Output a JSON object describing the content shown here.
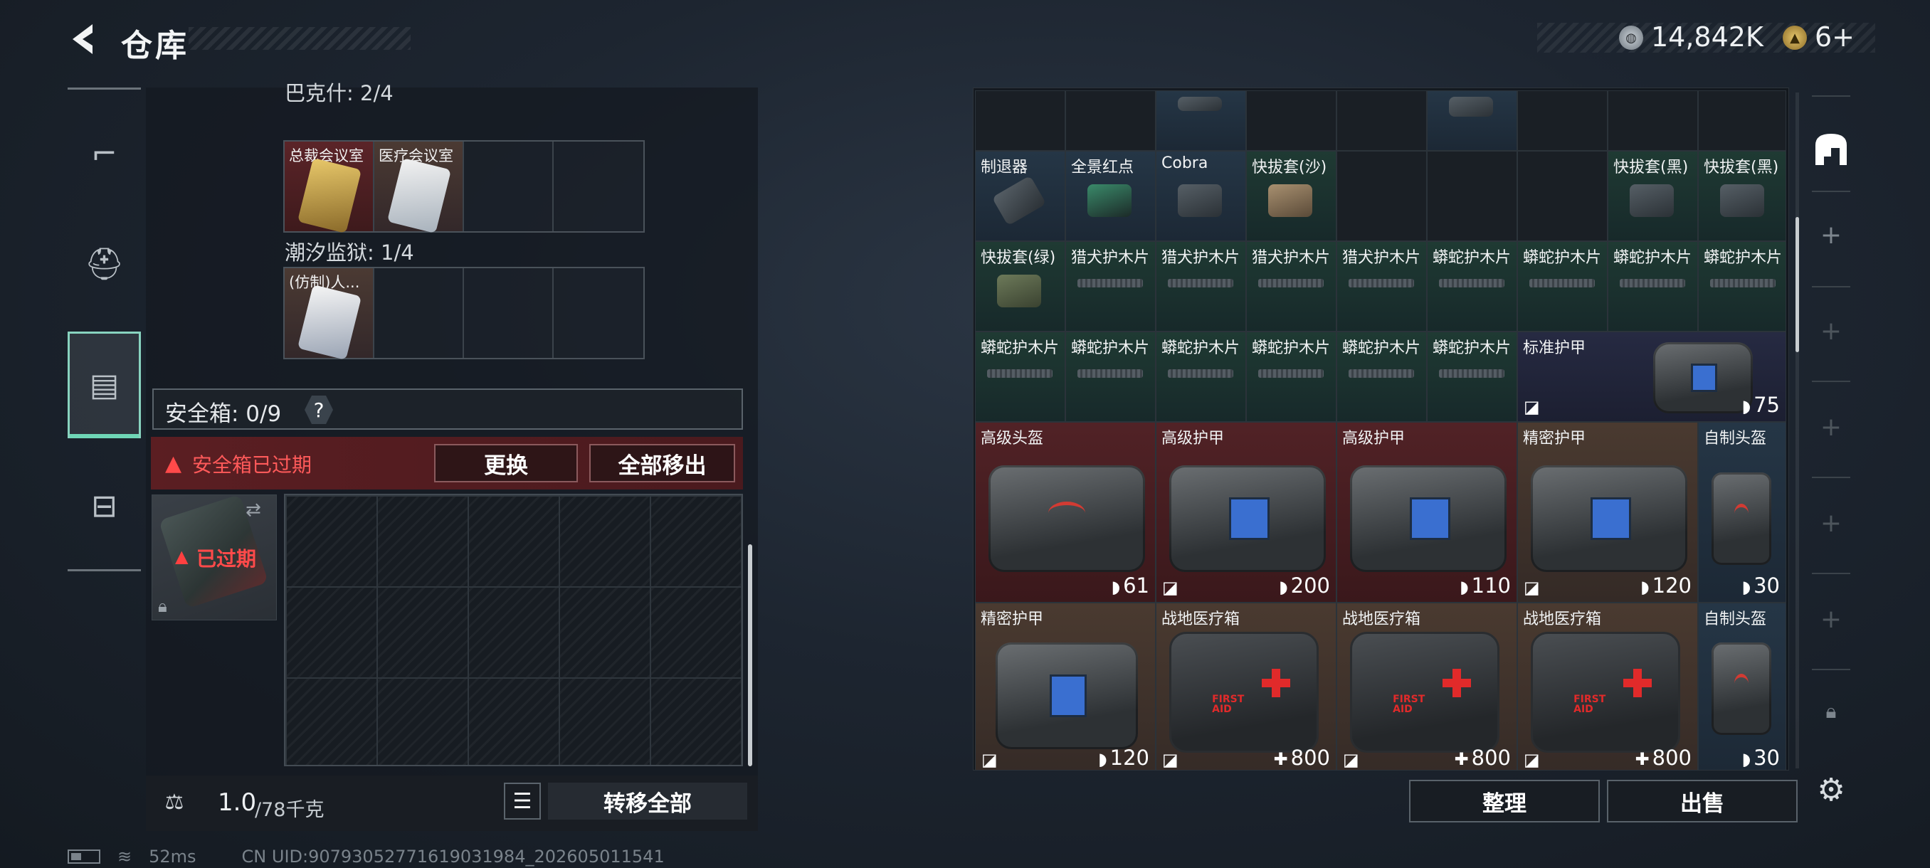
{
  "header": {
    "title": "仓库"
  },
  "currency": [
    {
      "icon": "silver-coin-icon",
      "value": "14,842K"
    },
    {
      "icon": "gold-coin-icon",
      "value": "6+"
    }
  ],
  "left_nav": [
    {
      "name": "weapons",
      "icon": "gun-icon"
    },
    {
      "name": "equipment",
      "icon": "backpack-icon"
    },
    {
      "name": "safe-box",
      "icon": "case-icon",
      "active": true
    },
    {
      "name": "toolbox",
      "icon": "toolbox-icon"
    }
  ],
  "keys": {
    "section1_label": "巴克什: 2/4",
    "section1_cells": [
      "总裁会议室",
      "医疗会议室",
      "",
      ""
    ],
    "section2_label": "潮汐监狱: 1/4",
    "section2_cells": [
      "(仿制)人...",
      "",
      "",
      ""
    ]
  },
  "safe": {
    "label": "安全箱: 0/9",
    "help": "?",
    "warning": "安全箱已过期",
    "replace_btn": "更换",
    "move_all_btn": "全部移出",
    "expired_label": "已过期"
  },
  "bottom_left": {
    "weight": "1.0",
    "weight_max": "/78千克",
    "transfer_all": "转移全部"
  },
  "status_bar": {
    "ping": "52ms",
    "uid": "CN UID:907930527716190319​84_202605011541"
  },
  "storage": {
    "row1": [
      {
        "label": "制退器",
        "color": "blue"
      },
      {
        "label": "全景红点",
        "color": "blue"
      },
      {
        "label": "Cobra",
        "color": "blue"
      },
      {
        "label": "快拔套(沙)",
        "color": "green"
      },
      {
        "label": "",
        "color": "dark"
      },
      {
        "label": "",
        "color": "dark"
      },
      {
        "label": "快拔套(黑)",
        "color": "green"
      },
      {
        "label": "快拔套(黑)",
        "color": "green"
      }
    ],
    "row2": [
      "快拔套(绿)",
      "猎犬护木片",
      "猎犬护木片",
      "猎犬护木片",
      "猎犬护木片",
      "蟒蛇护木片",
      "蟒蛇护木片",
      "蟒蛇护木片",
      "蟒蛇护木片"
    ],
    "row3": [
      "蟒蛇护木片",
      "蟒蛇护木片",
      "蟒蛇护木片",
      "蟒蛇护木片",
      "蟒蛇护木片",
      "蟒蛇护木片"
    ],
    "standard_armor": {
      "label": "标准护甲",
      "value": "75"
    },
    "row4": [
      {
        "label": "高级头盔",
        "value": "61"
      },
      {
        "label": "高级护甲",
        "value": "200"
      },
      {
        "label": "高级护甲",
        "value": "110"
      },
      {
        "label": "精密护甲",
        "value": "120"
      },
      {
        "label": "自制头盔",
        "value": "30"
      }
    ],
    "row5": [
      {
        "label": "精密护甲",
        "value": "120"
      },
      {
        "label": "战地医疗箱",
        "value": "800"
      },
      {
        "label": "战地医疗箱",
        "value": "800"
      },
      {
        "label": "战地医疗箱",
        "value": "800"
      },
      {
        "label": "自制头盔",
        "value": "30"
      }
    ],
    "sort_btn": "整理",
    "sell_btn": "出售"
  }
}
